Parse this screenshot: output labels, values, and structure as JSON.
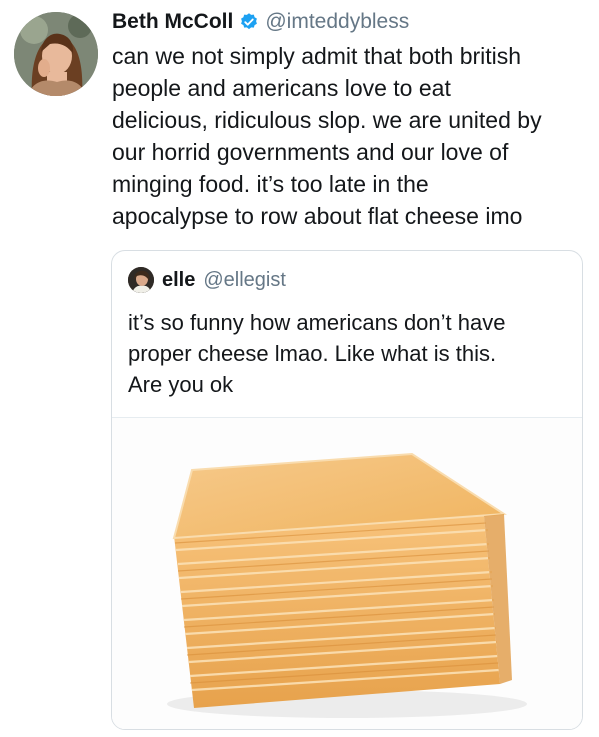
{
  "tweet": {
    "author_name": "Beth McColl",
    "author_handle": "@imteddybless",
    "verified_icon": "verified-badge-icon",
    "text_lines": [
      "can we not simply admit that both british",
      "people and americans love to eat",
      "delicious, ridiculous slop. we are united by",
      "our horrid governments and our love of",
      "minging food. it’s too late in the",
      "apocalypse to row about flat cheese imo"
    ]
  },
  "quoted": {
    "author_name": "elle",
    "author_handle": "@ellegist",
    "text_lines": [
      "it’s so funny how americans don’t have",
      "proper cheese lmao. Like what is this.",
      "Are you ok"
    ],
    "media_icon": "cheese-slices-photo"
  },
  "colors": {
    "text": "#14171a",
    "secondary": "#657786",
    "verified_blue": "#1da1f2",
    "card_border": "#d8dee3",
    "cheese": "#f2b55e"
  }
}
